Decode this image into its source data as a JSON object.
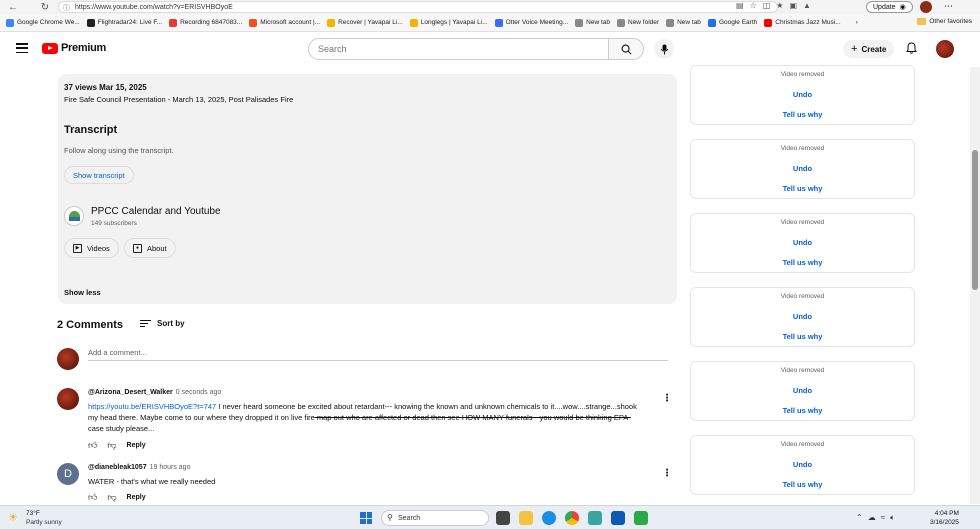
{
  "browser": {
    "url": "https://www.youtube.com/watch?v=ERISVHBOyoE",
    "update_label": "Update",
    "bookmarks": [
      {
        "label": "Google Chrome We...",
        "color": "#4285f4"
      },
      {
        "label": "Flightradar24: Live F...",
        "color": "#222222"
      },
      {
        "label": "Recording 6847083...",
        "color": "#e53935"
      },
      {
        "label": "Microsoft account |...",
        "color": "#f25022"
      },
      {
        "label": "Recover | Yavapai Li...",
        "color": "#f4b400"
      },
      {
        "label": "Longlegs | Yavapai Li...",
        "color": "#f4b400"
      },
      {
        "label": "Otter Voice Meeting...",
        "color": "#3b6cf4"
      },
      {
        "label": "New tab",
        "color": "#888888"
      },
      {
        "label": "New folder",
        "color": "#888888"
      },
      {
        "label": "New tab",
        "color": "#888888"
      },
      {
        "label": "Google Earth",
        "color": "#1a73e8"
      },
      {
        "label": "Christmas Jazz Musi...",
        "color": "#ff0000"
      }
    ],
    "other_favorites": "Other favorites"
  },
  "header": {
    "logo_text": "Premium",
    "search_placeholder": "Search",
    "create_label": "Create"
  },
  "description": {
    "stats": "37 views  Mar 15, 2025",
    "title": "Fire Safe Council Presentation - March 13, 2025, Post Palisades Fire",
    "transcript_heading": "Transcript",
    "transcript_sub": "Follow along using the transcript.",
    "show_transcript": "Show transcript",
    "channel_name": "PPCC Calendar and Youtube",
    "channel_subs": "149 subscribers",
    "videos_label": "Videos",
    "about_label": "About",
    "show_less": "Show less"
  },
  "comments": {
    "heading": "2 Comments",
    "sort_label": "Sort by",
    "add_placeholder": "Add a comment...",
    "reply_label": "Reply",
    "items": [
      {
        "author": "@Arizona_Desert_Walker",
        "time": "0 seconds ago",
        "link": "https://youtu.be/ERISVHBOyoE?t=747",
        "text_a": " I never heard someone be excited about retardant--- knowing the known and unknown chemicals to it....wow....strange...shook my head there. Maybe come to our where they dropped it on live fire",
        "text_strike": " map out who are affected or dead then see HOW MANY funerals-- you would be thinking EPA-",
        "text_b": " case study please..."
      },
      {
        "author": "@dianebleak1057",
        "time": "19 hours ago",
        "avatar_letter": "D",
        "text": "WATER - that's what we really needed"
      }
    ]
  },
  "sidebar": {
    "removed_label": "Video removed",
    "undo_label": "Undo",
    "tell_label": "Tell us why"
  },
  "taskbar": {
    "temp": "73°F",
    "weather": "Partly sunny",
    "search_label": "Search",
    "time": "4:04 PM",
    "date": "3/16/2025"
  }
}
